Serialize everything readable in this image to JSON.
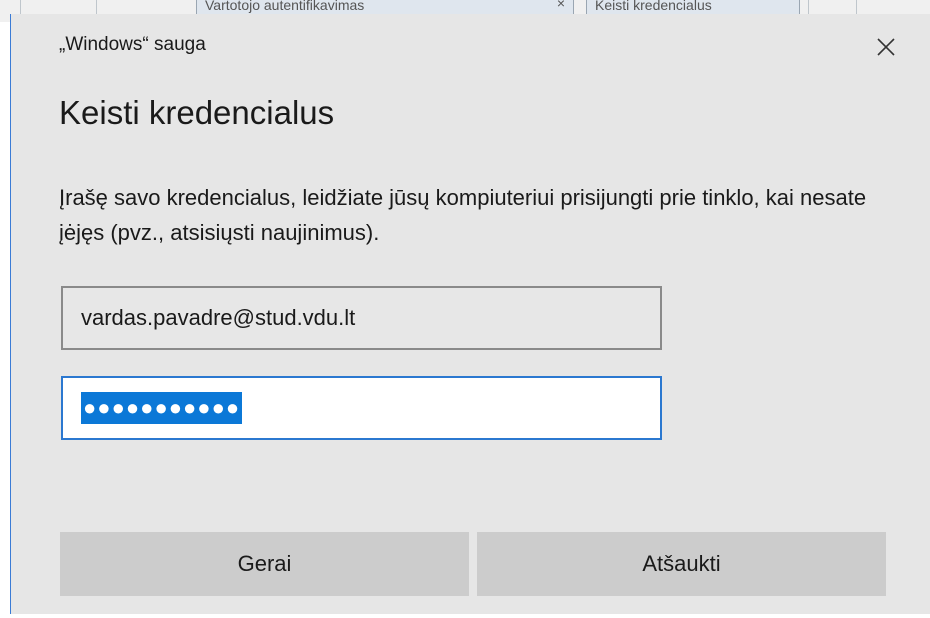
{
  "background": {
    "tab1_label": "Vartotojo autentifikavimas",
    "tab1_close": "×",
    "tab2_label": "Keisti kredencialus"
  },
  "dialog": {
    "caption": "„Windows“ sauga",
    "close_icon": "close-icon",
    "title": "Keisti kredencialus",
    "message": "Įrašę savo kredencialus, leidžiate jūsų kompiuteriui prisijungti prie tinklo, kai nesate įėjęs (pvz., atsisiųsti naujinimus).",
    "username_value": "vardas.pavadre@stud.vdu.lt",
    "password_masked": "●●●●●●●●●●●",
    "ok_label": "Gerai",
    "cancel_label": "Atšaukti"
  },
  "colors": {
    "dialog_bg": "#e6e6e6",
    "focus_border": "#2b78d0",
    "selection": "#0b78d7",
    "button_bg": "#cccccc"
  }
}
